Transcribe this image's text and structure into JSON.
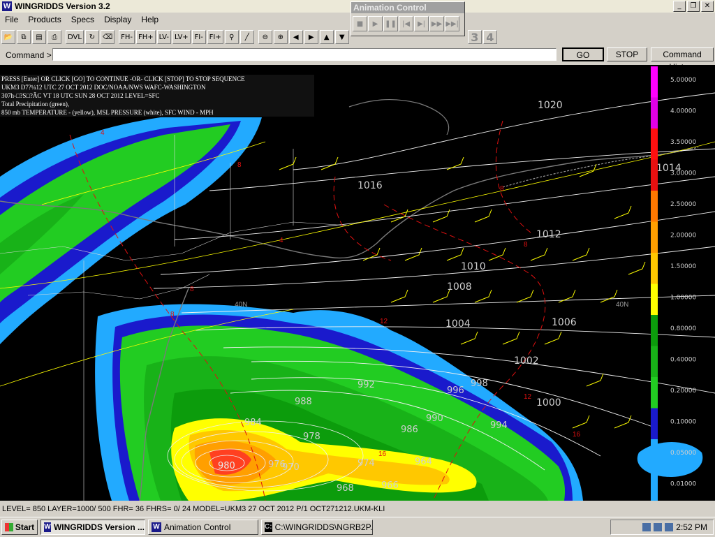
{
  "window": {
    "title": "WINGRIDDS Version 3.2",
    "min": "_",
    "max": "❐",
    "close": "✕"
  },
  "menu": [
    "File",
    "Products",
    "Specs",
    "Display",
    "Help"
  ],
  "toolbar": {
    "text_buttons": [
      "DVL",
      "FH-",
      "FH+",
      "LV-",
      "LV+",
      "FI-",
      "FI+"
    ],
    "numbers": [
      "3",
      "4"
    ]
  },
  "command": {
    "label": "Command >",
    "value": "",
    "go": "GO",
    "stop": "STOP",
    "history": "Command History"
  },
  "info_lines": [
    "PRESS [Enter] OR CLICK [GO] TO CONTINUE -OR- CLICK [STOP] TO STOP SEQUENCE",
    "UKM3    D7?¼12 UTC 27 OCT 2012    DOC/NOAA/NWS    WAFC-WASHINGTON",
    "307h-□?S□?ÃC    VT 18 UTC SUN 28 OCT 2012    LEVEL=SFC",
    "Total Precipitation (green),",
    "850 mb TEMPERATURE - (yellow), MSL PRESSURE (white), SFC WIND - MPH"
  ],
  "pressure_labels": [
    "1020",
    "1016",
    "1014",
    "1012",
    "1010",
    "1008",
    "1006",
    "1004",
    "1002",
    "1000",
    "998",
    "996",
    "994",
    "992",
    "990",
    "988",
    "986",
    "984",
    "980",
    "978",
    "976",
    "974",
    "970",
    "968",
    "966",
    "964"
  ],
  "temperature_labels": [
    "4",
    "8",
    "8",
    "8",
    "4",
    "8",
    "8",
    "12",
    "12",
    "16",
    "16"
  ],
  "lat_labels": [
    "40N",
    "40N"
  ],
  "color_scale": {
    "values": [
      "5.00000",
      "4.00000",
      "3.50000",
      "3.00000",
      "2.50000",
      "2.00000",
      "1.50000",
      "1.00000",
      "0.80000",
      "0.40000",
      "0.20000",
      "0.10000",
      "0.05000",
      "0.01000"
    ],
    "colors": [
      "#ff00ff",
      "#e100e6",
      "#ff1010",
      "#e81010",
      "#ff7800",
      "#ff9f00",
      "#ffc800",
      "#ffff00",
      "#0c9c0c",
      "#18b218",
      "#22cc22",
      "#1a1acc",
      "#22aaff",
      "#22aaff"
    ]
  },
  "status": "LEVEL= 850 LAYER=1000/ 500 FHR= 36 FHRS=   0/ 24 MODEL=UKM3  27 OCT 2012 P/1 OCT271212.UKM-KLI",
  "animation": {
    "title": "Animation Control",
    "buttons": [
      "■",
      "▶",
      "❚❚",
      "|◀",
      "▶|",
      "▶▶",
      "▶▶|"
    ]
  },
  "taskbar": {
    "start": "Start",
    "tasks": [
      "WINGRIDDS Version ...",
      "Animation Control",
      "C:\\WINGRIDDS\\NGRB2P..."
    ],
    "time": "2:52 PM"
  }
}
